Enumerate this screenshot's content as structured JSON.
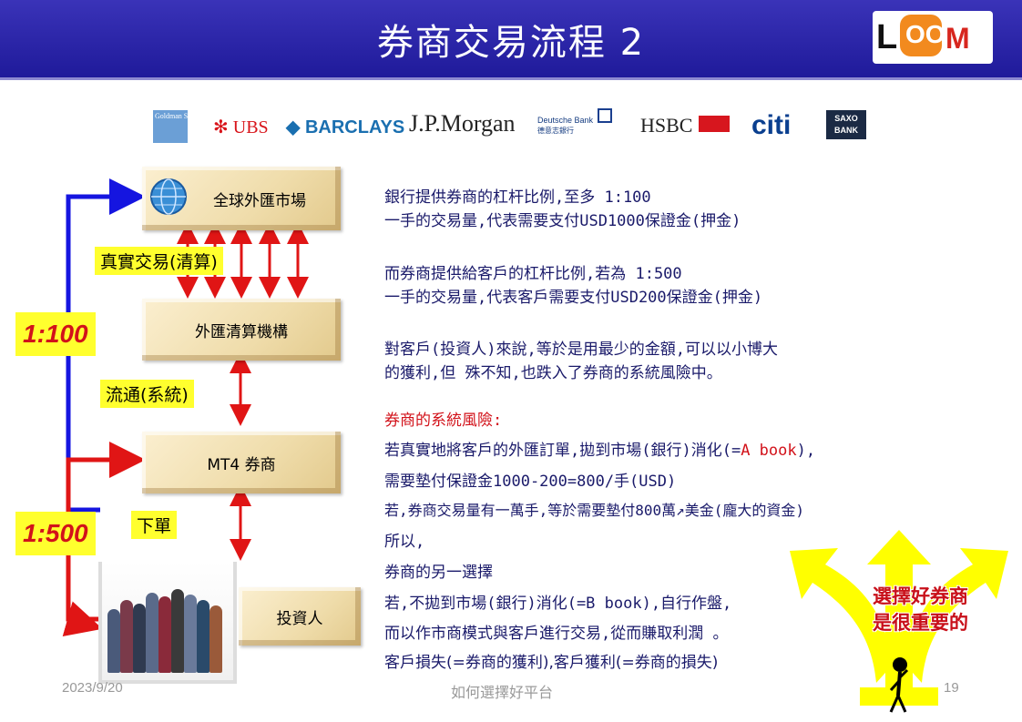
{
  "title": "券商交易流程 2",
  "logo": {
    "l": "L",
    "oo": "OO",
    "m": "M"
  },
  "banks": {
    "goldman": "Goldman Sachs",
    "ubs": "UBS",
    "barclays": "BARCLAYS",
    "jpmorgan": "J.P.Morgan",
    "deutsche": "Deutsche Bank",
    "deutsche_cn": "德意志銀行",
    "hsbc": "HSBC",
    "citi": "citi",
    "saxo_line1": "SAXO",
    "saxo_line2": "BANK"
  },
  "flow": {
    "global_market": "全球外匯市場",
    "clearing": "外匯清算機構",
    "broker": "MT4 券商",
    "investor": "投資人",
    "real_trade": "真實交易(清算)",
    "circulation": "流通(系統)",
    "order": "下單",
    "ratio_bank": "1:100",
    "ratio_broker": "1:500"
  },
  "text": {
    "l1": "銀行提供券商的杠杆比例,至多 1:100",
    "l2": "一手的交易量,代表需要支付USD1000保證金(押金)",
    "l3": "而券商提供給客戶的杠杆比例,若為 1:500",
    "l4": "一手的交易量,代表客戶需要支付USD200保證金(押金)",
    "l5": "對客戶(投資人)來說,等於是用最少的金額,可以以小博大",
    "l6": "的獲利,但 殊不知,也跌入了券商的系統風險中。",
    "risk_title": "券商的系統風險:",
    "r1": "若真實地將客戶的外匯訂單,拋到市場(銀行)消化(=A book),",
    "r2": "需要墊付保證金1000-200=800/手(USD)",
    "r3": "若,券商交易量有一萬手,等於需要墊付800萬↗美金(龐大的資金)",
    "r4": "所以,",
    "r5": "券商的另一選擇",
    "r6": "若,不拋到市場(銀行)消化(=B book),自行作盤,",
    "r7": "而以作市商模式與客戶進行交易,從而賺取利潤 。",
    "r8": "客戶損失(=券商的獲利),客戶獲利(=券商的損失)"
  },
  "callout": {
    "line1": "選擇好券商",
    "line2": "是很重要的"
  },
  "footer": {
    "date": "2023/9/20",
    "center": "如何選擇好平台",
    "page": "19"
  },
  "colors": {
    "title_bar": "#2a24ad",
    "accent_red": "#d2121a",
    "highlight": "#ffff2e",
    "text": "#1a1a6a"
  }
}
